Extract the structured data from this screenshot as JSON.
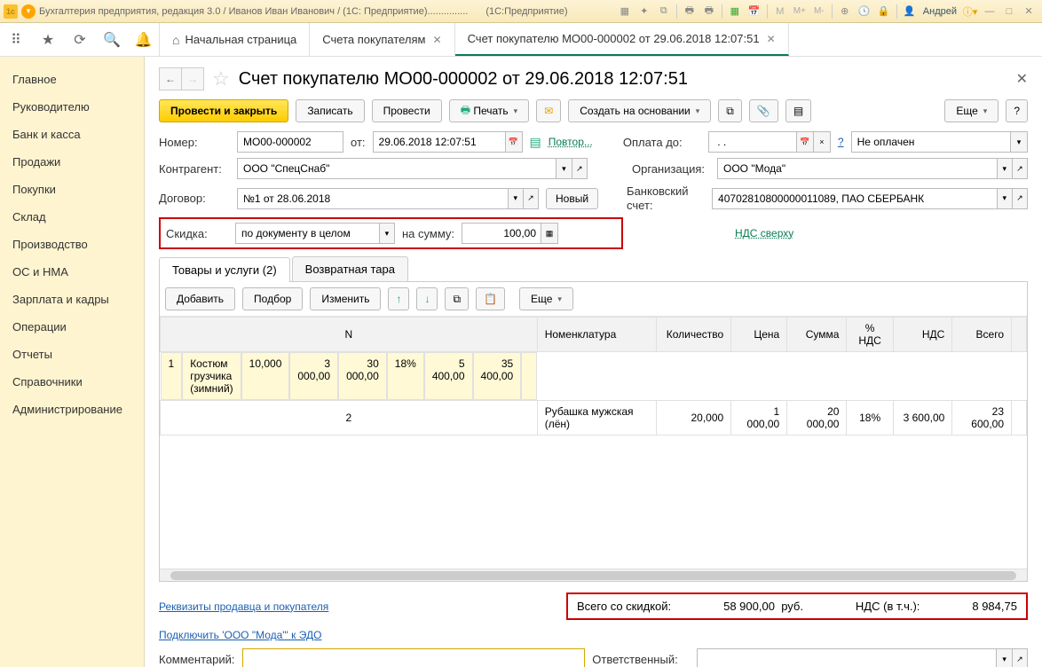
{
  "titlebar": {
    "title_left": "Бухгалтерия предприятия, редакция 3.0 / Иванов Иван Иванович / (1С: Предприятие)...............",
    "title_right": "(1С:Предприятие)",
    "user": "Андрей",
    "m1": "M",
    "m2": "M+",
    "m3": "M-"
  },
  "tabs": {
    "home": "Начальная страница",
    "t1": "Счета покупателям",
    "t2": "Счет покупателю МО00-000002 от 29.06.2018 12:07:51"
  },
  "sidebar": {
    "items": [
      "Главное",
      "Руководителю",
      "Банк и касса",
      "Продажи",
      "Покупки",
      "Склад",
      "Производство",
      "ОС и НМА",
      "Зарплата и кадры",
      "Операции",
      "Отчеты",
      "Справочники",
      "Администрирование"
    ]
  },
  "page": {
    "title": "Счет покупателю МО00-000002 от 29.06.2018 12:07:51"
  },
  "toolbar": {
    "post_close": "Провести и закрыть",
    "save": "Записать",
    "post": "Провести",
    "print": "Печать",
    "create_based": "Создать на основании",
    "more": "Еще"
  },
  "form": {
    "number_lbl": "Номер:",
    "number": "МО00-000002",
    "from_lbl": "от:",
    "date": "29.06.2018 12:07:51",
    "repeat": "Повтор...",
    "paydue_lbl": "Оплата до:",
    "paydue": " . .",
    "status": "Не оплачен",
    "counterparty_lbl": "Контрагент:",
    "counterparty": "ООО \"СпецСнаб\"",
    "org_lbl": "Организация:",
    "org": "ООО \"Мода\"",
    "contract_lbl": "Договор:",
    "contract": "№1 от 28.06.2018",
    "new_btn": "Новый",
    "bank_lbl": "Банковский счет:",
    "bank": "40702810800000011089, ПАО СБЕРБАНК",
    "discount_lbl": "Скидка:",
    "discount_type": "по документу в целом",
    "onsum_lbl": "на сумму:",
    "onsum": "100,00",
    "vat_link": "НДС сверху"
  },
  "tabs2": {
    "goods": "Товары и услуги (2)",
    "tara": "Возвратная тара"
  },
  "tblbar": {
    "add": "Добавить",
    "pick": "Подбор",
    "edit": "Изменить",
    "more": "Еще"
  },
  "table": {
    "headers": [
      "N",
      "Номенклатура",
      "Количество",
      "Цена",
      "Сумма",
      "% НДС",
      "НДС",
      "Всего"
    ],
    "rows": [
      {
        "n": "1",
        "name": "Костюм грузчика (зимний)",
        "qty": "10,000",
        "price": "3 000,00",
        "sum": "30 000,00",
        "vatp": "18%",
        "vat": "5 400,00",
        "total": "35 400,00"
      },
      {
        "n": "2",
        "name": "Рубашка мужская (лён)",
        "qty": "20,000",
        "price": "1 000,00",
        "sum": "20 000,00",
        "vatp": "18%",
        "vat": "3 600,00",
        "total": "23 600,00"
      }
    ]
  },
  "footer": {
    "req_link": "Реквизиты продавца и покупателя",
    "edo_link": "Подключить 'ООО \"Мода\"' к ЭДО",
    "total_lbl": "Всего со скидкой:",
    "total": "58 900,00",
    "cur": "руб.",
    "vat_lbl": "НДС (в т.ч.):",
    "vat": "8 984,75",
    "comment_lbl": "Комментарий:",
    "resp_lbl": "Ответственный:"
  }
}
